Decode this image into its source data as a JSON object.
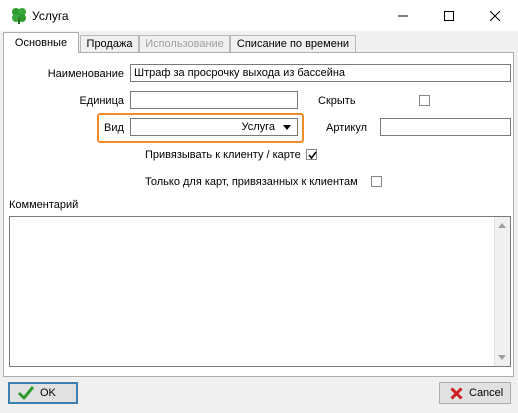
{
  "window": {
    "title": "Услуга",
    "icon": "clover-icon",
    "controls": [
      "minimize-icon",
      "maximize-icon",
      "close-icon"
    ]
  },
  "tabs": [
    {
      "label": "Основные",
      "state": "active"
    },
    {
      "label": "Продажа",
      "state": "normal"
    },
    {
      "label": "Использование",
      "state": "disabled"
    },
    {
      "label": "Списание по времени",
      "state": "normal"
    }
  ],
  "form": {
    "name_label": "Наименование",
    "name_value": "Штраф за просрочку выхода из бассейна",
    "unit_label": "Единица",
    "unit_value": "",
    "hide_label": "Скрыть",
    "hide_checked": false,
    "type_label": "Вид",
    "type_value": "Услуга",
    "article_label": "Артикул",
    "article_value": "",
    "bind_client_label": "Привязывать к клиенту / карте",
    "bind_client_checked": true,
    "only_cards_label": "Только для карт, привязанных к клиентам",
    "only_cards_checked": false,
    "comment_label": "Комментарий",
    "comment_value": ""
  },
  "buttons": {
    "ok_label": "OK",
    "cancel_label": "Cancel"
  },
  "colors": {
    "highlight": "#f28c28",
    "ok_border": "#3c7fb1",
    "check_ok": "#2e9b2e",
    "cross_cancel": "#cc1f1f"
  }
}
